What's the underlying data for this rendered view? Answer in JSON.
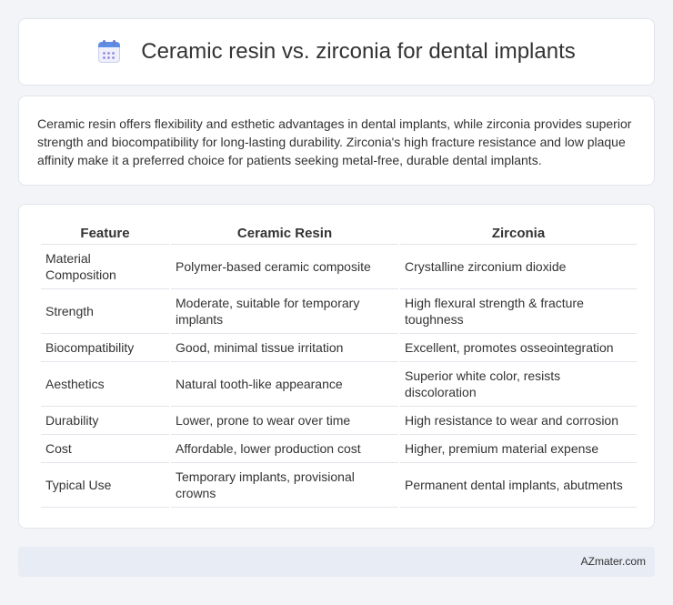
{
  "header": {
    "title": "Ceramic resin vs. zirconia for dental implants",
    "icon": "calendar-icon"
  },
  "description": "Ceramic resin offers flexibility and esthetic advantages in dental implants, while zirconia provides superior strength and biocompatibility for long-lasting durability. Zirconia's high fracture resistance and low plaque affinity make it a preferred choice for patients seeking metal-free, durable dental implants.",
  "table": {
    "headers": [
      "Feature",
      "Ceramic Resin",
      "Zirconia"
    ],
    "rows": [
      [
        "Material Composition",
        "Polymer-based ceramic composite",
        "Crystalline zirconium dioxide"
      ],
      [
        "Strength",
        "Moderate, suitable for temporary implants",
        "High flexural strength & fracture toughness"
      ],
      [
        "Biocompatibility",
        "Good, minimal tissue irritation",
        "Excellent, promotes osseointegration"
      ],
      [
        "Aesthetics",
        "Natural tooth-like appearance",
        "Superior white color, resists discoloration"
      ],
      [
        "Durability",
        "Lower, prone to wear over time",
        "High resistance to wear and corrosion"
      ],
      [
        "Cost",
        "Affordable, lower production cost",
        "Higher, premium material expense"
      ],
      [
        "Typical Use",
        "Temporary implants, provisional crowns",
        "Permanent dental implants, abutments"
      ]
    ]
  },
  "footer": {
    "brand": "AZmater.com"
  }
}
